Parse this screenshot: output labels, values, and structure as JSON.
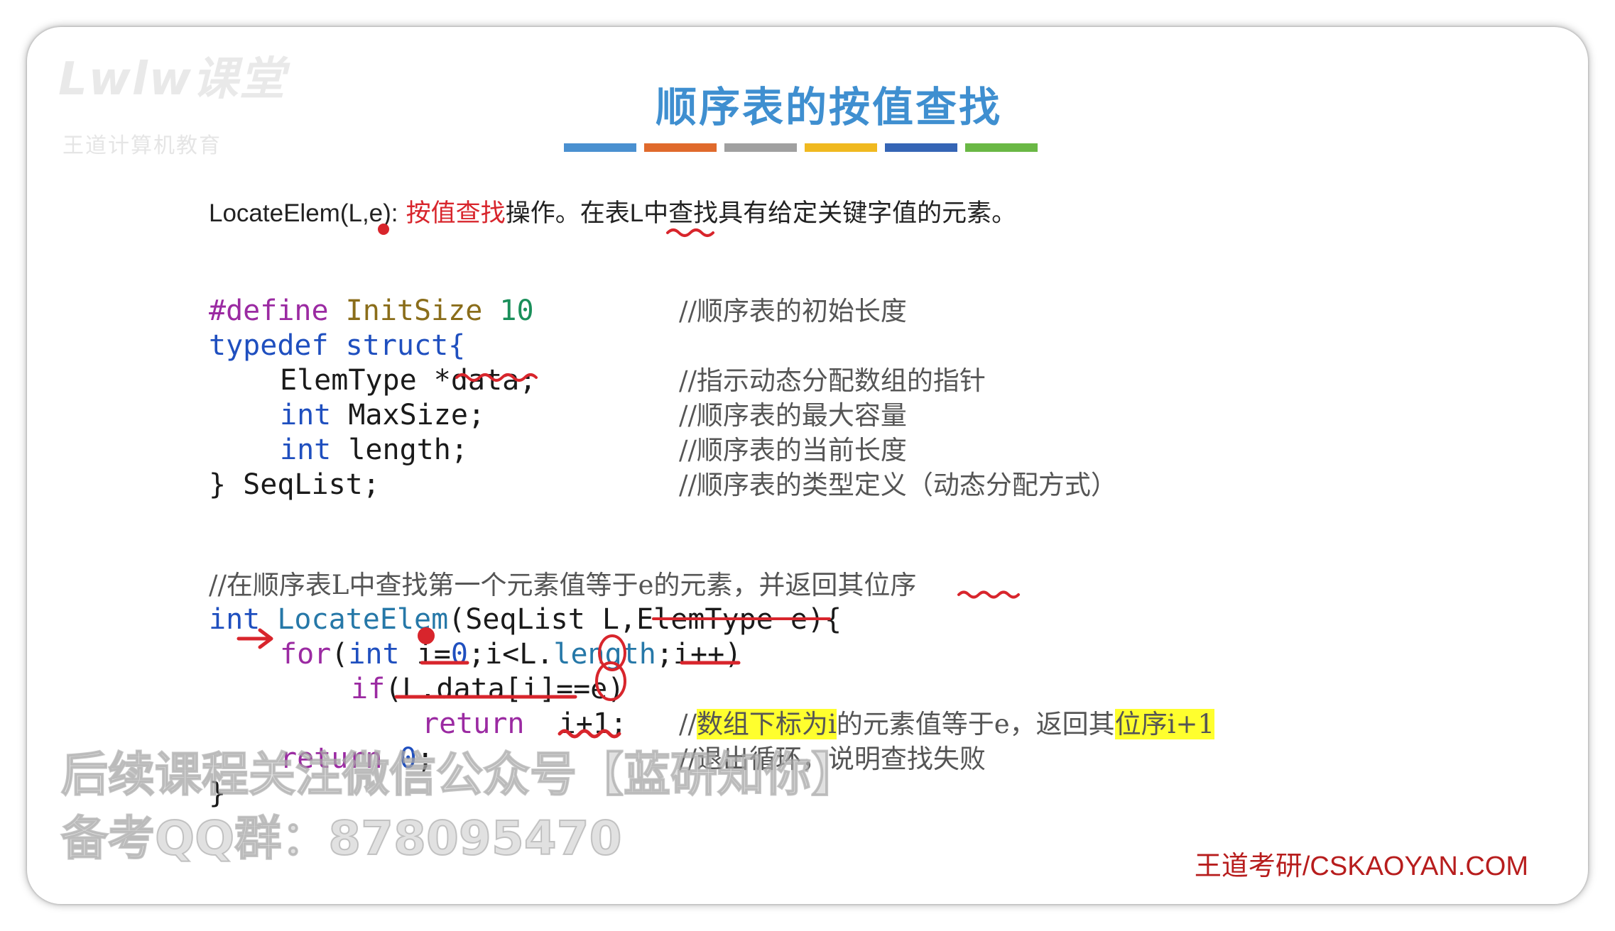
{
  "logo": {
    "text": "Lwlw课堂",
    "subtext": "王道计算机教育"
  },
  "title": "顺序表的按值查找",
  "colors": {
    "title": "#3f8fd0",
    "title_bar": [
      "#4a90d0",
      "#e06a2c",
      "#a0a0a0",
      "#f0b920",
      "#3565b5",
      "#6ab845"
    ],
    "highlight": "#ffff2e",
    "ink": "#d8252c",
    "footer": "#b71d1d"
  },
  "description": {
    "signature": "LocateElem(L,e):",
    "red_part": "按值查找",
    "rest_1": "操作。在表",
    "L": "L",
    "rest_2": "中查找具有给定关键字值的元素。"
  },
  "struct_code": {
    "line1": {
      "define": "#define",
      "name": "InitSize",
      "value": "10",
      "comment": "//顺序表的初始长度"
    },
    "line2": {
      "typedef": "typedef",
      "struct": "struct{"
    },
    "line3": {
      "type": "ElemType ",
      "rest": "*data;",
      "comment": "//指示动态分配数组的指针"
    },
    "line4": {
      "int": "int",
      "rest": " MaxSize;",
      "comment": "//顺序表的最大容量"
    },
    "line5": {
      "int": "int",
      "rest": " length;",
      "comment": "//顺序表的当前长度"
    },
    "line6": {
      "text": "} SeqList;",
      "comment": "//顺序表的类型定义（动态分配方式）"
    }
  },
  "func_code": {
    "comment": "//在顺序表L中查找第一个元素值等于e的元素，并返回其位序",
    "sig_int": "int",
    "sig_name": "LocateElem",
    "sig_params": "(SeqList L,ElemType e){",
    "for_kw": "for",
    "for_int": "int",
    "for_i": "i=",
    "for_zero": "0",
    "for_mid": ";i<L.",
    "for_len": "length",
    "for_end": ";i++)",
    "if_kw": "if",
    "if_body": "(L.data[i]==e)",
    "ret1_kw": "return",
    "ret1_val": "i+1;",
    "ret1_comment_a": "//",
    "ret1_comment_b": "数组下标为i",
    "ret1_comment_c": "的元素值等于e，返回其",
    "ret1_comment_d": "位序i+1",
    "ret0_kw": "return",
    "ret0_val": "0",
    "ret0_end": ";",
    "ret0_comment": "//退出循环，说明查找失败",
    "close": "}"
  },
  "watermark": {
    "line1": "后续课程关注微信公众号【蓝研知你】",
    "line2": "备考QQ群：878095470"
  },
  "footer": "王道考研/CSKAOYAN.COM"
}
